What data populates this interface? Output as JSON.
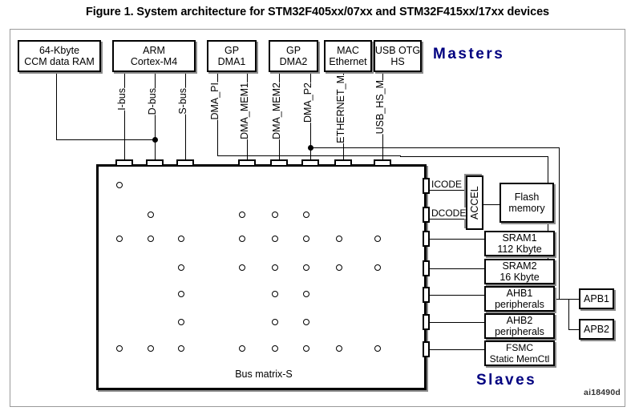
{
  "figure": {
    "caption": "Figure 1. System architecture for STM32F405xx/07xx and STM32F415xx/17xx devices",
    "doc_id": "ai18490d",
    "accent_color": "#000080"
  },
  "roles": {
    "masters_label": "Masters",
    "slaves_label": "Slaves"
  },
  "masters": [
    {
      "id": "ccm-ram",
      "line1": "64-Kbyte",
      "line2": "CCM data RAM"
    },
    {
      "id": "cortex-m4",
      "line1": "ARM",
      "line2": "Cortex-M4"
    },
    {
      "id": "gp-dma1",
      "line1": "GP",
      "line2": "DMA1"
    },
    {
      "id": "gp-dma2",
      "line1": "GP",
      "line2": "DMA2"
    },
    {
      "id": "mac-eth",
      "line1": "MAC",
      "line2": "Ethernet"
    },
    {
      "id": "usb-otg-hs",
      "line1": "USB OTG",
      "line2": "HS"
    }
  ],
  "bus_ports": [
    {
      "id": "i-bus",
      "label": "I-bus"
    },
    {
      "id": "d-bus",
      "label": "D-bus"
    },
    {
      "id": "s-bus",
      "label": "S-bus"
    },
    {
      "id": "dma-pi",
      "label": "DMA_PI"
    },
    {
      "id": "dma-mem1",
      "label": "DMA_MEM1"
    },
    {
      "id": "dma-mem2",
      "label": "DMA_MEM2"
    },
    {
      "id": "dma-p2",
      "label": "DMA_P2"
    },
    {
      "id": "ethernet-m",
      "label": "ETHERNET_M"
    },
    {
      "id": "usb-hs-m",
      "label": "USB_HS_M"
    }
  ],
  "bus_matrix": {
    "label": "Bus matrix-S",
    "master_columns": [
      "I-bus",
      "D-bus",
      "S-bus",
      "DMA_MEM1",
      "DMA_MEM2",
      "DMA_P2",
      "ETHERNET_M",
      "USB_HS_M"
    ],
    "slave_rows": [
      "ICODE",
      "DCODE",
      "SRAM1",
      "SRAM2",
      "AHB1",
      "AHB2",
      "FSMC"
    ],
    "crosspoints": [
      [
        1,
        0,
        0,
        0,
        0,
        0,
        0,
        0
      ],
      [
        0,
        1,
        0,
        1,
        1,
        1,
        0,
        0
      ],
      [
        1,
        1,
        1,
        1,
        1,
        1,
        1,
        1
      ],
      [
        0,
        0,
        1,
        1,
        1,
        1,
        1,
        1
      ],
      [
        0,
        0,
        1,
        0,
        1,
        1,
        0,
        0
      ],
      [
        0,
        0,
        1,
        0,
        1,
        1,
        0,
        0
      ],
      [
        1,
        1,
        1,
        1,
        1,
        1,
        1,
        1
      ]
    ]
  },
  "slave_ports": [
    {
      "id": "icode",
      "label": "ICODE"
    },
    {
      "id": "dcode",
      "label": "DCODE"
    }
  ],
  "slaves": [
    {
      "id": "accel",
      "line1": "ACCEL",
      "line2": ""
    },
    {
      "id": "flash-memory",
      "line1": "Flash",
      "line2": "memory"
    },
    {
      "id": "sram1",
      "line1": "SRAM1",
      "line2": "112 Kbyte"
    },
    {
      "id": "sram2",
      "line1": "SRAM2",
      "line2": "16 Kbyte"
    },
    {
      "id": "ahb1",
      "line1": "AHB1",
      "line2": "peripherals"
    },
    {
      "id": "ahb2",
      "line1": "AHB2",
      "line2": "peripherals"
    },
    {
      "id": "fsmc",
      "line1": "FSMC",
      "line2": "Static MemCtl"
    }
  ],
  "buses": [
    {
      "id": "apb1",
      "line1": "APB1",
      "line2": ""
    },
    {
      "id": "apb2",
      "line1": "APB2",
      "line2": ""
    }
  ]
}
